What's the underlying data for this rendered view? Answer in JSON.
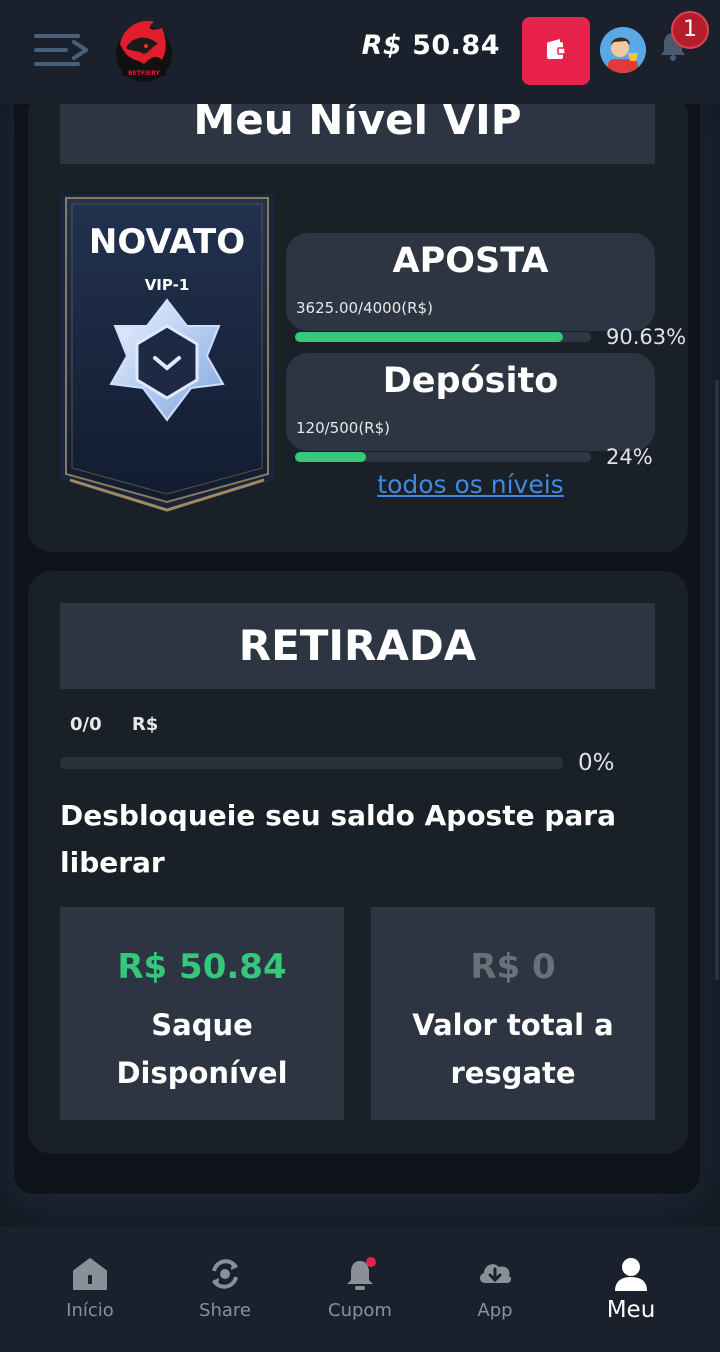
{
  "header": {
    "balance_currency": "R$",
    "balance_amount": "50.84",
    "notification_count": "1",
    "colors": {
      "wallet": "#e8224a",
      "badge": "#b51d2c"
    }
  },
  "vip": {
    "title": "Meu Nível VIP",
    "badge_name": "NOVATO",
    "badge_level": "VIP-1",
    "bet": {
      "label": "APOSTA",
      "value": "3625.00/4000(R$)",
      "percent": "90.63%",
      "fraction": 0.9063
    },
    "deposit": {
      "label": "Depósito",
      "value": "120/500(R$)",
      "percent": "24%",
      "fraction": 0.24
    },
    "all_levels_link": "todos os níveis"
  },
  "withdraw": {
    "title": "RETIRADA",
    "progress_value": "0/0",
    "progress_currency": "R$",
    "percent": "0%",
    "fraction": 0,
    "message": "Desbloqueie seu saldo Aposte para liberar",
    "available": {
      "amount": "R$ 50.84",
      "label": "Saque Disponível",
      "color": "#35c77a"
    },
    "total": {
      "amount": "R$ 0",
      "label": "Valor total a resgate",
      "color": "#6b7078"
    }
  },
  "nav": {
    "items": [
      {
        "label": "Início",
        "icon": "home-icon"
      },
      {
        "label": "Share",
        "icon": "share-icon"
      },
      {
        "label": "Cupom",
        "icon": "bell-icon"
      },
      {
        "label": "App",
        "icon": "cloud-download-icon"
      },
      {
        "label": "Meu",
        "icon": "user-icon"
      }
    ],
    "active": "Meu"
  }
}
